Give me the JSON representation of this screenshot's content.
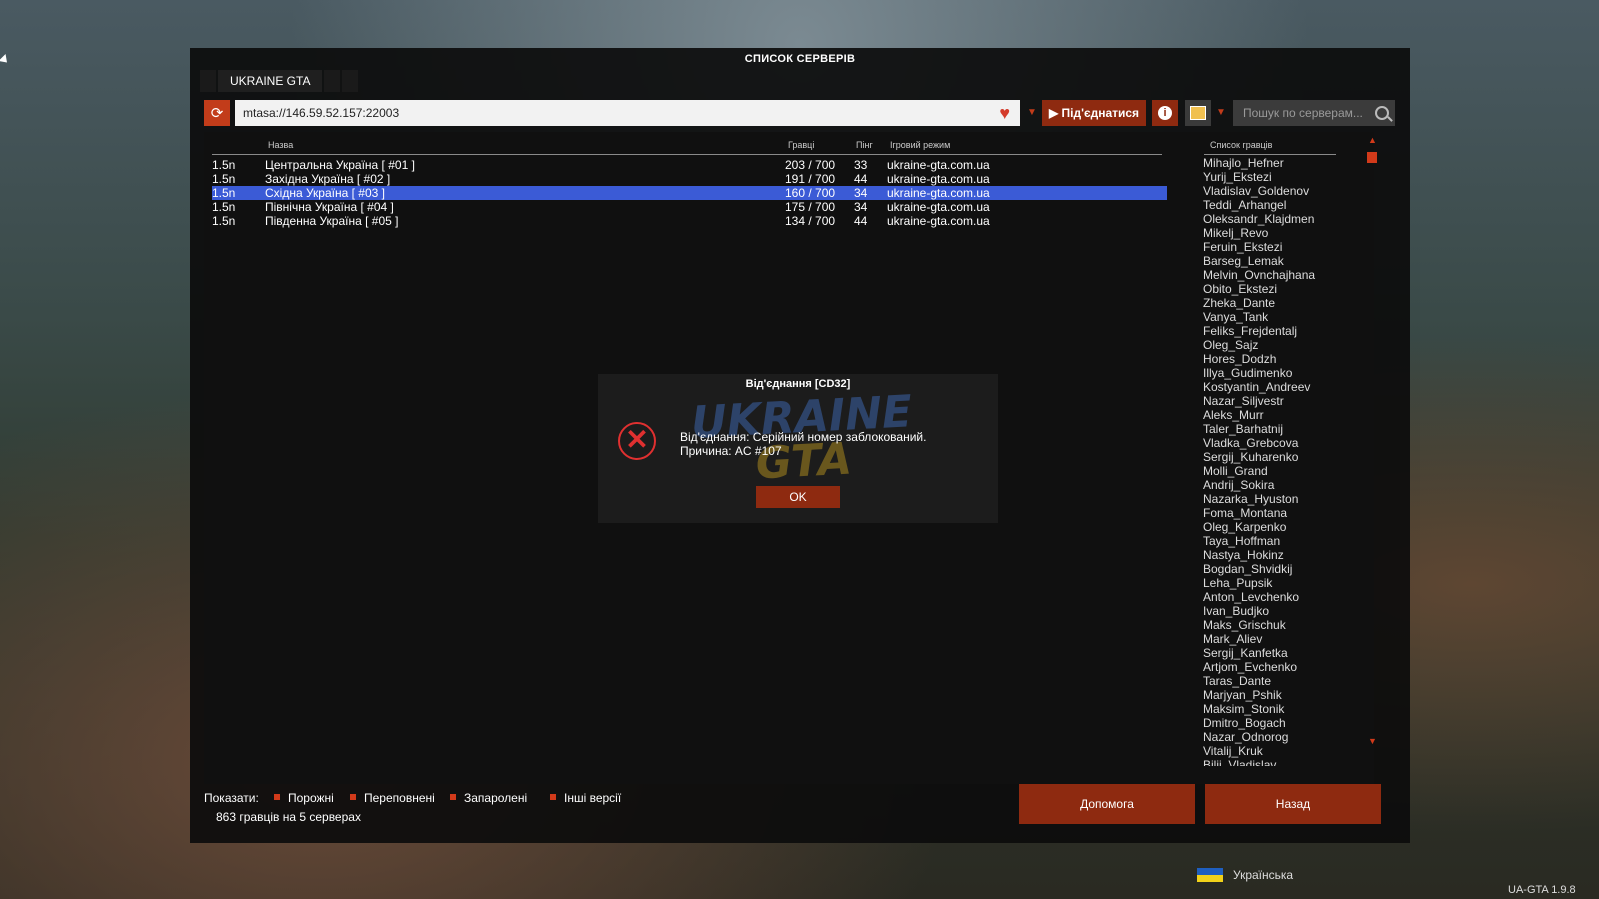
{
  "window": {
    "title": "СПИСОК СЕРВЕРІВ",
    "tab": "UKRAINE GTA"
  },
  "toolbar": {
    "address": "mtasa://146.59.52.157:22003",
    "connect_label": "Під'єднатися",
    "search_placeholder": "Пошук по серверам..."
  },
  "columns": {
    "name": "Назва",
    "players": "Гравці",
    "ping": "Пінг",
    "mode": "Ігровий режим"
  },
  "servers": [
    {
      "ver": "1.5n",
      "name": "Центральна Україна [ #01 ]",
      "players": "203 / 700",
      "ping": "33",
      "mode": "ukraine-gta.com.ua"
    },
    {
      "ver": "1.5n",
      "name": "Західна Україна [ #02 ]",
      "players": "191 / 700",
      "ping": "44",
      "mode": "ukraine-gta.com.ua"
    },
    {
      "ver": "1.5n",
      "name": "Східна Україна [ #03 ]",
      "players": "160 / 700",
      "ping": "34",
      "mode": "ukraine-gta.com.ua"
    },
    {
      "ver": "1.5n",
      "name": "Північна Україна [ #04 ]",
      "players": "175 / 700",
      "ping": "34",
      "mode": "ukraine-gta.com.ua"
    },
    {
      "ver": "1.5n",
      "name": "Південна Україна [ #05 ]",
      "players": "134 / 700",
      "ping": "44",
      "mode": "ukraine-gta.com.ua"
    }
  ],
  "player_list": {
    "title": "Список гравців",
    "names": [
      "Mihajlo_Hefner",
      "Yurij_Ekstezi",
      "Vladislav_Goldenov",
      "Teddi_Arhangel",
      "Oleksandr_Klajdmen",
      "Mikelj_Revo",
      "Feruin_Ekstezi",
      "Barseg_Lemak",
      "Melvin_Ovnchajhana",
      "Obito_Ekstezi",
      "Zheka_Dante",
      "Vanya_Tank",
      "Feliks_Frejdentalj",
      "Oleg_Sajz",
      "Hores_Dodzh",
      "Illya_Gudimenko",
      "Kostyantin_Andreev",
      "Nazar_Siljvestr",
      "Aleks_Murr",
      "Taler_Barhatnij",
      "Vladka_Grebcova",
      "Sergij_Kuharenko",
      "Molli_Grand",
      "Andrij_Sokira",
      "Nazarka_Hyuston",
      "Foma_Montana",
      "Oleg_Karpenko",
      "Taya_Hoffman",
      "Nastya_Hokinz",
      "Bogdan_Shvidkij",
      "Leha_Pupsik",
      "Anton_Levchenko",
      "Ivan_Budjko",
      "Maks_Grischuk",
      "Mark_Aliev",
      "Sergij_Kanfetka",
      "Artjom_Evchenko",
      "Taras_Dante",
      "Marjyan_Pshik",
      "Maksim_Stonik",
      "Dmitro_Bogach",
      "Nazar_Odnorog",
      "Vitalij_Kruk",
      "Bilij_Vladislav"
    ]
  },
  "filters": {
    "label": "Показати:",
    "items": [
      "Порожні",
      "Переповнені",
      "Запаролені",
      "Інші версії"
    ]
  },
  "count": "863 гравців на 5 серверах",
  "buttons": {
    "help": "Допомога",
    "back": "Назад"
  },
  "dialog": {
    "title": "Від'єднання [CD32]",
    "watermark_top": "UKRAINE",
    "watermark_bottom": "GTA",
    "line1": "Від'єднання: Серійний номер заблокований.",
    "line2": "Причина: AC #107",
    "ok": "OK"
  },
  "footer": {
    "language": "Українська",
    "version": "UA-GTA 1.9.8"
  }
}
